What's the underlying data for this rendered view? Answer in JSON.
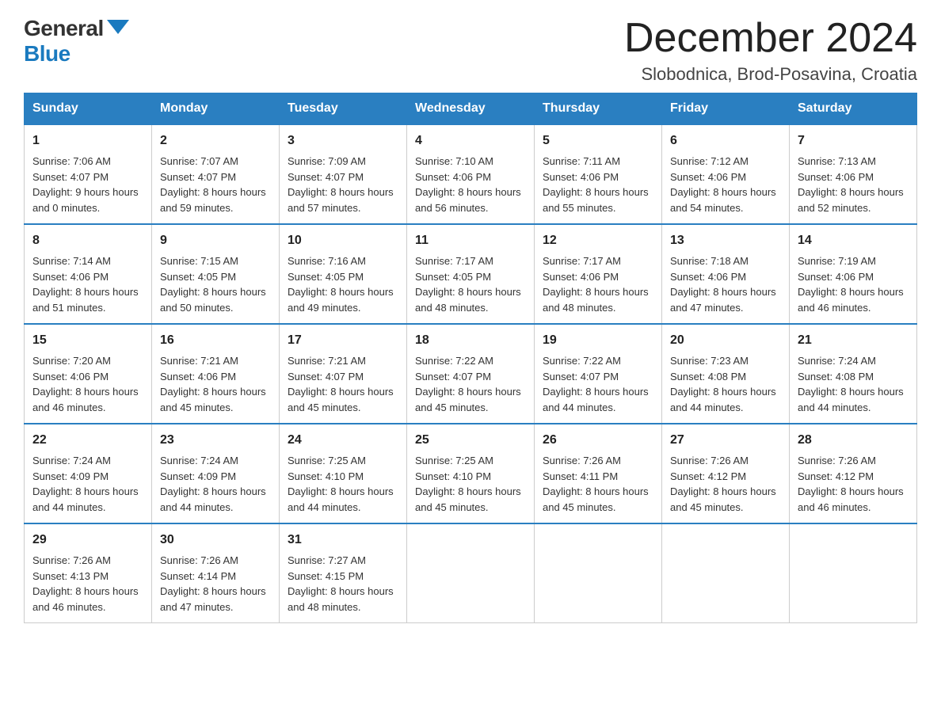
{
  "logo": {
    "general": "General",
    "blue": "Blue"
  },
  "header": {
    "month": "December 2024",
    "location": "Slobodnica, Brod-Posavina, Croatia"
  },
  "days_of_week": [
    "Sunday",
    "Monday",
    "Tuesday",
    "Wednesday",
    "Thursday",
    "Friday",
    "Saturday"
  ],
  "weeks": [
    [
      {
        "day": "1",
        "sunrise": "7:06 AM",
        "sunset": "4:07 PM",
        "daylight": "9 hours and 0 minutes."
      },
      {
        "day": "2",
        "sunrise": "7:07 AM",
        "sunset": "4:07 PM",
        "daylight": "8 hours and 59 minutes."
      },
      {
        "day": "3",
        "sunrise": "7:09 AM",
        "sunset": "4:07 PM",
        "daylight": "8 hours and 57 minutes."
      },
      {
        "day": "4",
        "sunrise": "7:10 AM",
        "sunset": "4:06 PM",
        "daylight": "8 hours and 56 minutes."
      },
      {
        "day": "5",
        "sunrise": "7:11 AM",
        "sunset": "4:06 PM",
        "daylight": "8 hours and 55 minutes."
      },
      {
        "day": "6",
        "sunrise": "7:12 AM",
        "sunset": "4:06 PM",
        "daylight": "8 hours and 54 minutes."
      },
      {
        "day": "7",
        "sunrise": "7:13 AM",
        "sunset": "4:06 PM",
        "daylight": "8 hours and 52 minutes."
      }
    ],
    [
      {
        "day": "8",
        "sunrise": "7:14 AM",
        "sunset": "4:06 PM",
        "daylight": "8 hours and 51 minutes."
      },
      {
        "day": "9",
        "sunrise": "7:15 AM",
        "sunset": "4:05 PM",
        "daylight": "8 hours and 50 minutes."
      },
      {
        "day": "10",
        "sunrise": "7:16 AM",
        "sunset": "4:05 PM",
        "daylight": "8 hours and 49 minutes."
      },
      {
        "day": "11",
        "sunrise": "7:17 AM",
        "sunset": "4:05 PM",
        "daylight": "8 hours and 48 minutes."
      },
      {
        "day": "12",
        "sunrise": "7:17 AM",
        "sunset": "4:06 PM",
        "daylight": "8 hours and 48 minutes."
      },
      {
        "day": "13",
        "sunrise": "7:18 AM",
        "sunset": "4:06 PM",
        "daylight": "8 hours and 47 minutes."
      },
      {
        "day": "14",
        "sunrise": "7:19 AM",
        "sunset": "4:06 PM",
        "daylight": "8 hours and 46 minutes."
      }
    ],
    [
      {
        "day": "15",
        "sunrise": "7:20 AM",
        "sunset": "4:06 PM",
        "daylight": "8 hours and 46 minutes."
      },
      {
        "day": "16",
        "sunrise": "7:21 AM",
        "sunset": "4:06 PM",
        "daylight": "8 hours and 45 minutes."
      },
      {
        "day": "17",
        "sunrise": "7:21 AM",
        "sunset": "4:07 PM",
        "daylight": "8 hours and 45 minutes."
      },
      {
        "day": "18",
        "sunrise": "7:22 AM",
        "sunset": "4:07 PM",
        "daylight": "8 hours and 45 minutes."
      },
      {
        "day": "19",
        "sunrise": "7:22 AM",
        "sunset": "4:07 PM",
        "daylight": "8 hours and 44 minutes."
      },
      {
        "day": "20",
        "sunrise": "7:23 AM",
        "sunset": "4:08 PM",
        "daylight": "8 hours and 44 minutes."
      },
      {
        "day": "21",
        "sunrise": "7:24 AM",
        "sunset": "4:08 PM",
        "daylight": "8 hours and 44 minutes."
      }
    ],
    [
      {
        "day": "22",
        "sunrise": "7:24 AM",
        "sunset": "4:09 PM",
        "daylight": "8 hours and 44 minutes."
      },
      {
        "day": "23",
        "sunrise": "7:24 AM",
        "sunset": "4:09 PM",
        "daylight": "8 hours and 44 minutes."
      },
      {
        "day": "24",
        "sunrise": "7:25 AM",
        "sunset": "4:10 PM",
        "daylight": "8 hours and 44 minutes."
      },
      {
        "day": "25",
        "sunrise": "7:25 AM",
        "sunset": "4:10 PM",
        "daylight": "8 hours and 45 minutes."
      },
      {
        "day": "26",
        "sunrise": "7:26 AM",
        "sunset": "4:11 PM",
        "daylight": "8 hours and 45 minutes."
      },
      {
        "day": "27",
        "sunrise": "7:26 AM",
        "sunset": "4:12 PM",
        "daylight": "8 hours and 45 minutes."
      },
      {
        "day": "28",
        "sunrise": "7:26 AM",
        "sunset": "4:12 PM",
        "daylight": "8 hours and 46 minutes."
      }
    ],
    [
      {
        "day": "29",
        "sunrise": "7:26 AM",
        "sunset": "4:13 PM",
        "daylight": "8 hours and 46 minutes."
      },
      {
        "day": "30",
        "sunrise": "7:26 AM",
        "sunset": "4:14 PM",
        "daylight": "8 hours and 47 minutes."
      },
      {
        "day": "31",
        "sunrise": "7:27 AM",
        "sunset": "4:15 PM",
        "daylight": "8 hours and 48 minutes."
      },
      null,
      null,
      null,
      null
    ]
  ],
  "labels": {
    "sunrise": "Sunrise:",
    "sunset": "Sunset:",
    "daylight": "Daylight:"
  }
}
